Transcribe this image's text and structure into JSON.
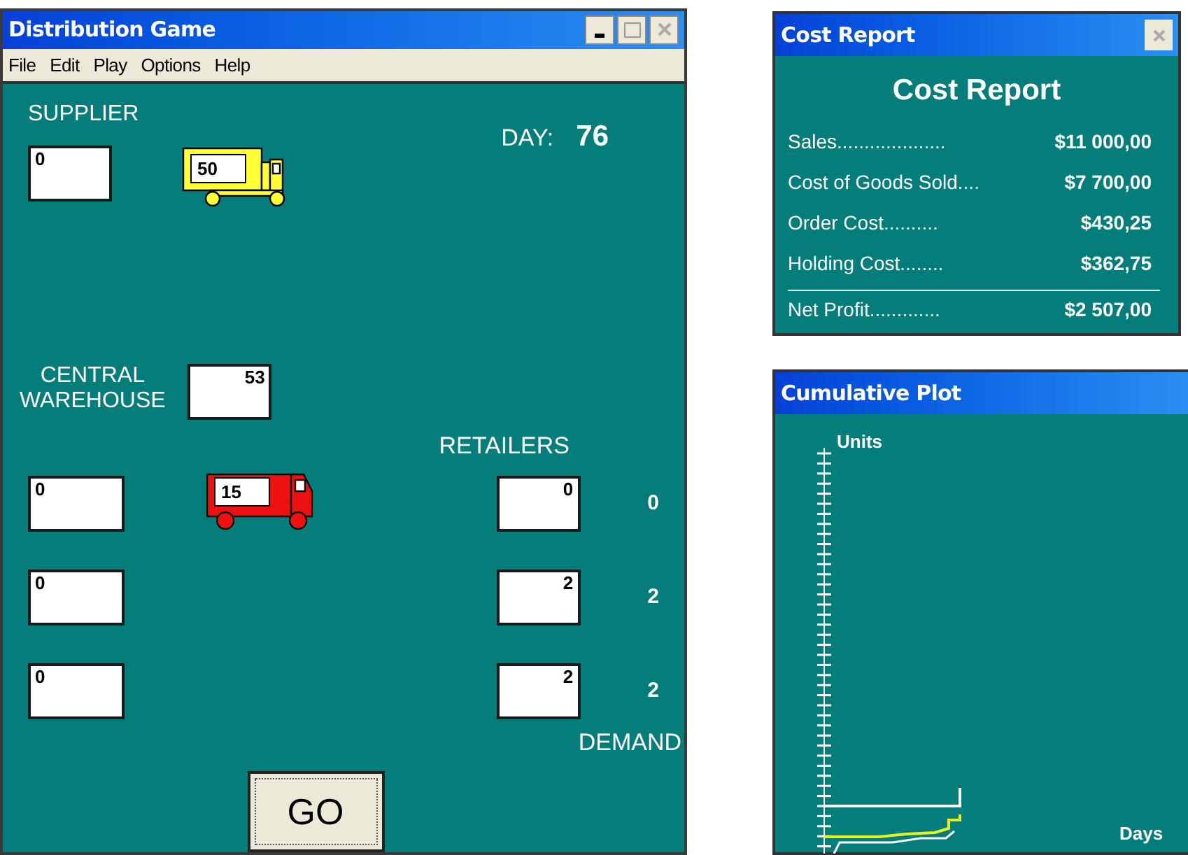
{
  "game": {
    "title": "Distribution Game",
    "menu": [
      "File",
      "Edit",
      "Play",
      "Options",
      "Help"
    ],
    "supplier": {
      "label": "SUPPLIER",
      "stock": "0",
      "truck_load": "50"
    },
    "day": {
      "label": "DAY:",
      "value": "76"
    },
    "warehouse": {
      "label_lines": [
        "CENTRAL",
        "WAREHOUSE"
      ],
      "stock": "53",
      "truck_load": "15"
    },
    "retailers_label": "RETAILERS",
    "rows": [
      {
        "order": "0",
        "stock": "0",
        "demand": "0"
      },
      {
        "order": "0",
        "stock": "2",
        "demand": "2"
      },
      {
        "order": "0",
        "stock": "2",
        "demand": "2"
      }
    ],
    "demand_label": "DEMAND",
    "go_button": "GO"
  },
  "cost_report": {
    "title": "Cost Report",
    "heading": "Cost Report",
    "lines": [
      {
        "label": "Sales....................",
        "value": "$11 000,00"
      },
      {
        "label": "Cost of Goods Sold....",
        "value": "$7 700,00"
      },
      {
        "label": "Order Cost..........",
        "value": "$430,25"
      },
      {
        "label": "Holding Cost........",
        "value": "$362,75"
      }
    ],
    "total": {
      "label": "Net Profit.............",
      "value": "$2 507,00"
    }
  },
  "plot": {
    "title": "Cumulative Plot",
    "ylabel": "Units",
    "xlabel": "Days"
  }
}
